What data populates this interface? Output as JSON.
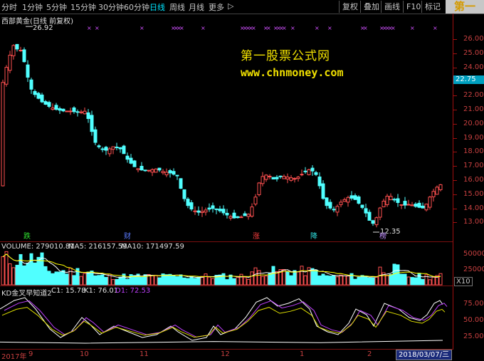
{
  "toolbar": {
    "left": [
      "分时",
      "1分钟",
      "5分钟",
      "15分钟",
      "30分钟",
      "60分钟",
      "日线",
      "周线",
      "月线",
      "更多"
    ],
    "active": "日线",
    "more_arrow": "▷",
    "right": [
      "复权",
      "叠加",
      "画线",
      "F10",
      "标记"
    ],
    "logo": "第一"
  },
  "header": {
    "title": "西部黄金(日线 前复权)"
  },
  "watermark": {
    "line1": "第一股票公式网",
    "line2": "www.chnmoney.com"
  },
  "price_axis": {
    "labels": [
      "26.00",
      "25.00",
      "24.00",
      "23.00",
      "22.00",
      "21.00",
      "20.00",
      "19.00",
      "18.00",
      "17.00",
      "16.00",
      "15.00",
      "14.00",
      "13.00"
    ],
    "current": "22.75"
  },
  "annotations": {
    "high": "26.92",
    "low": "12.35"
  },
  "markers": {
    "glyph": "×",
    "count_text": "×"
  },
  "events": [
    {
      "label": "跌",
      "color": "#30e030"
    },
    {
      "label": "财",
      "color": "#5b7bff"
    },
    {
      "label": "涨",
      "color": "#ff4040"
    },
    {
      "label": "降",
      "color": "#30e0e0"
    },
    {
      "label": "榜",
      "color": "#c090ff"
    }
  ],
  "volume": {
    "title": "VOLUME: 279010.81",
    "ma5": "MA5: 216157.59",
    "ma10": "MA10: 171497.59",
    "axis": [
      "50000",
      "25000"
    ],
    "unit": "X10"
  },
  "kd": {
    "title": "KD金叉早知道2",
    "c1": "C1: 15.78",
    "k1": "K1: 76.01",
    "d1": "D1: 72.53",
    "axis": [
      "75.00",
      "50.00",
      "25.00"
    ]
  },
  "xaxis": {
    "labels": [
      "2017年",
      "9",
      "10",
      "11",
      "12",
      "1",
      "2"
    ],
    "date": "2018/03/07/三"
  },
  "colors": {
    "up": "#ff5050",
    "down": "#50ffff",
    "bg": "#000000",
    "axis": "#a01010"
  }
}
